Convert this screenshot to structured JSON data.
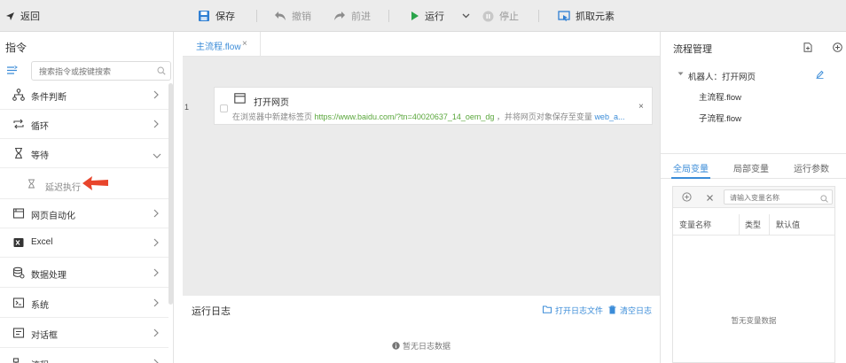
{
  "toolbar": {
    "back": "返回",
    "save": "保存",
    "undo": "撤销",
    "redo": "前进",
    "run": "运行",
    "stop": "停止",
    "capture": "抓取元素"
  },
  "left": {
    "title": "指令",
    "search_placeholder": "搜索指令或按键搜索",
    "categories": [
      {
        "label": "条件判断",
        "icon": "branch-icon"
      },
      {
        "label": "循环",
        "icon": "loop-icon"
      },
      {
        "label": "等待",
        "icon": "hourglass-icon",
        "expanded": true
      },
      {
        "label": "网页自动化",
        "icon": "browser-icon"
      },
      {
        "label": "Excel",
        "icon": "excel-icon"
      },
      {
        "label": "数据处理",
        "icon": "data-icon"
      },
      {
        "label": "系统",
        "icon": "terminal-icon"
      },
      {
        "label": "对话框",
        "icon": "dialog-icon"
      },
      {
        "label": "流程",
        "icon": "flow-icon"
      }
    ],
    "sub_item": "延迟执行"
  },
  "center": {
    "tab": "主流程.flow",
    "tab_close": "×",
    "line_number": "1",
    "card": {
      "title": "打开网页",
      "desc_prefix": "在浏览器中新建标签页 ",
      "desc_url": "https://www.baidu.com/?tn=40020637_14_oem_dg",
      "desc_mid": " ，并将网页对象保存至变量 ",
      "desc_var": "web_a...",
      "close": "×"
    },
    "log": {
      "title": "运行日志",
      "open_file": "打开日志文件",
      "clear": "清空日志",
      "empty": "暂无日志数据"
    }
  },
  "right": {
    "title": "流程管理",
    "robot": "机器人：打开网页",
    "flows": [
      "主流程.flow",
      "子流程.flow"
    ],
    "var_tabs": [
      "全局变量",
      "局部变量",
      "运行参数"
    ],
    "var_search_placeholder": "请输入变量名称",
    "columns": [
      "变量名称",
      "类型",
      "默认值"
    ],
    "empty": "暂无变量数据"
  },
  "colors": {
    "accent": "#3b8cd8",
    "run_green": "#2aa44a",
    "arrow_red": "#e8452c",
    "url_green": "#5aa73c"
  }
}
